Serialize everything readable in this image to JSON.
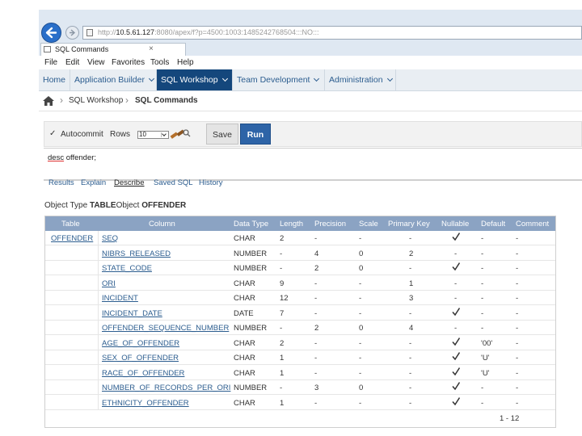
{
  "browser": {
    "url_prefix": "http://",
    "url_host": "10.5.61.127",
    "url_rest": ":8080/apex/f?p=4500:1003:1485242768504:::NO:::",
    "tab_title": "SQL Commands",
    "close_glyph": "×"
  },
  "menu": [
    "File",
    "Edit",
    "View",
    "Favorites",
    "Tools",
    "Help"
  ],
  "app_nav": [
    {
      "label": "Home",
      "caret": false,
      "active": false
    },
    {
      "label": "Application Builder",
      "caret": true,
      "active": false
    },
    {
      "label": "SQL Workshop",
      "caret": true,
      "active": true
    },
    {
      "label": "Team Development",
      "caret": true,
      "active": false
    },
    {
      "label": "Administration",
      "caret": true,
      "active": false
    }
  ],
  "breadcrumb": {
    "sep": "›",
    "items": [
      "SQL Workshop",
      "SQL Commands"
    ]
  },
  "toolbar": {
    "autocommit_label": "Autocommit",
    "rows_label": "Rows",
    "rows_value": "10",
    "save_label": "Save",
    "run_label": "Run",
    "check_glyph": "✓"
  },
  "editor": {
    "keyword": "desc",
    "rest": " offender;"
  },
  "result_tabs": [
    {
      "label": "Results",
      "active": false
    },
    {
      "label": "Explain",
      "active": false
    },
    {
      "label": "Describe",
      "active": true
    },
    {
      "label": "Saved SQL",
      "active": false
    },
    {
      "label": "History",
      "active": false
    }
  ],
  "object": {
    "type_label": "Object Type",
    "type_value": "TABLE",
    "object_label": "Object",
    "object_value": "OFFENDER"
  },
  "table": {
    "name": "OFFENDER",
    "headers": [
      "Table",
      "Column",
      "Data Type",
      "Length",
      "Precision",
      "Scale",
      "Primary Key",
      "Nullable",
      "Default",
      "Comment"
    ],
    "rows": [
      [
        "SEQ",
        "CHAR",
        "2",
        "-",
        "-",
        "-",
        true,
        "-",
        "-"
      ],
      [
        "NIBRS_RELEASED",
        "NUMBER",
        "-",
        "4",
        "0",
        "2",
        false,
        "-",
        "-"
      ],
      [
        "STATE_CODE",
        "NUMBER",
        "-",
        "2",
        "0",
        "-",
        true,
        "-",
        "-"
      ],
      [
        "ORI",
        "CHAR",
        "9",
        "-",
        "-",
        "1",
        false,
        "-",
        "-"
      ],
      [
        "INCIDENT",
        "CHAR",
        "12",
        "-",
        "-",
        "3",
        false,
        "-",
        "-"
      ],
      [
        "INCIDENT_DATE",
        "DATE",
        "7",
        "-",
        "-",
        "-",
        true,
        "-",
        "-"
      ],
      [
        "OFFENDER_SEQUENCE_NUMBER",
        "NUMBER",
        "-",
        "2",
        "0",
        "4",
        false,
        "-",
        "-"
      ],
      [
        "AGE_OF_OFFENDER",
        "CHAR",
        "2",
        "-",
        "-",
        "-",
        true,
        "'00'",
        "-"
      ],
      [
        "SEX_OF_OFFENDER",
        "CHAR",
        "1",
        "-",
        "-",
        "-",
        true,
        "'U'",
        "-"
      ],
      [
        "RACE_OF_OFFENDER",
        "CHAR",
        "1",
        "-",
        "-",
        "-",
        true,
        "'U'",
        "-"
      ],
      [
        "NUMBER_OF_RECORDS_PER_ORI",
        "NUMBER",
        "-",
        "3",
        "0",
        "-",
        true,
        "-",
        "-"
      ],
      [
        "ETHNICITY_OFFENDER",
        "CHAR",
        "1",
        "-",
        "-",
        "-",
        true,
        "-",
        "-"
      ]
    ],
    "pager": "1 - 12"
  },
  "colors": {
    "nav_active": "#14477c",
    "header_bg": "#8ba3c3",
    "run_button": "#2e64a7",
    "link": "#2c5d8f"
  },
  "icons": [
    "back-arrow-icon",
    "forward-arrow-icon",
    "page-icon",
    "home-icon",
    "check-icon",
    "find-icon",
    "checkmark-icon"
  ]
}
